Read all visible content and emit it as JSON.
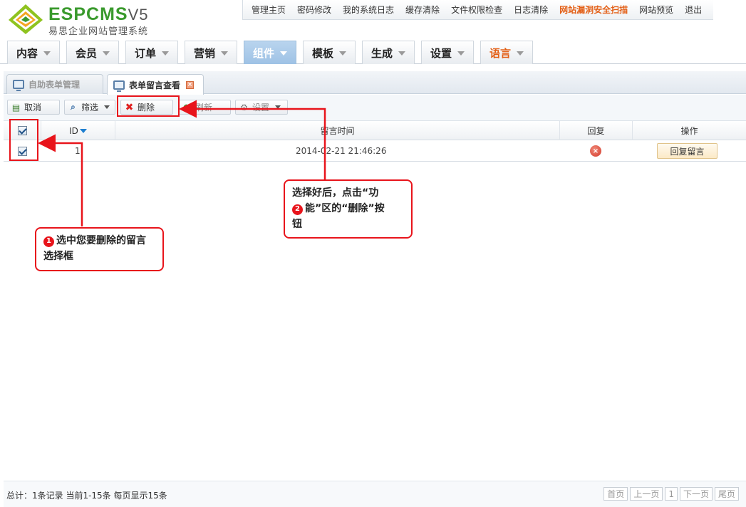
{
  "brand": {
    "name": "ESPCMS",
    "version": "V5",
    "subtitle": "易思企业网站管理系统"
  },
  "top_links": [
    {
      "label": "管理主页"
    },
    {
      "label": "密码修改"
    },
    {
      "label": "我的系统日志"
    },
    {
      "label": "缓存清除"
    },
    {
      "label": "文件权限检查"
    },
    {
      "label": "日志清除"
    },
    {
      "label": "网站漏洞安全扫描"
    },
    {
      "label": "网站预览"
    },
    {
      "label": "退出"
    }
  ],
  "main_menu": [
    {
      "label": "内容"
    },
    {
      "label": "会员"
    },
    {
      "label": "订单"
    },
    {
      "label": "营销"
    },
    {
      "label": "组件"
    },
    {
      "label": "模板"
    },
    {
      "label": "生成"
    },
    {
      "label": "设置"
    },
    {
      "label": "语言"
    }
  ],
  "tabs": [
    {
      "label": "自助表单管理"
    },
    {
      "label": "表单留言查看"
    }
  ],
  "toolbar": {
    "cancel": "取消",
    "filter": "筛选",
    "delete": "删除",
    "refresh": "刷新",
    "settings": "设置"
  },
  "table": {
    "headers": {
      "id": "ID",
      "time": "留言时间",
      "reply": "回复",
      "action": "操作"
    },
    "rows": [
      {
        "id": "1",
        "time": "2014-02-21 21:46:26",
        "action": "回复留言"
      }
    ]
  },
  "footer": {
    "summary": "总计：1条记录 当前1-15条 每页显示15条",
    "first": "首页",
    "prev": "上一页",
    "page": "1",
    "next": "下一页",
    "last": "尾页"
  },
  "annotations": {
    "step1_num": "1",
    "step1_line1": "选中您要删除的留言",
    "step1_line2": "选择框",
    "step2_num": "2",
    "step2_line1": "选择好后，点击“功",
    "step2_line2": "能”区的“删除”按",
    "step2_line3": "钮"
  },
  "colors": {
    "accent_red": "#e8141b",
    "warning_orange": "#e35f16",
    "brand_green": "#3a9a2d"
  }
}
